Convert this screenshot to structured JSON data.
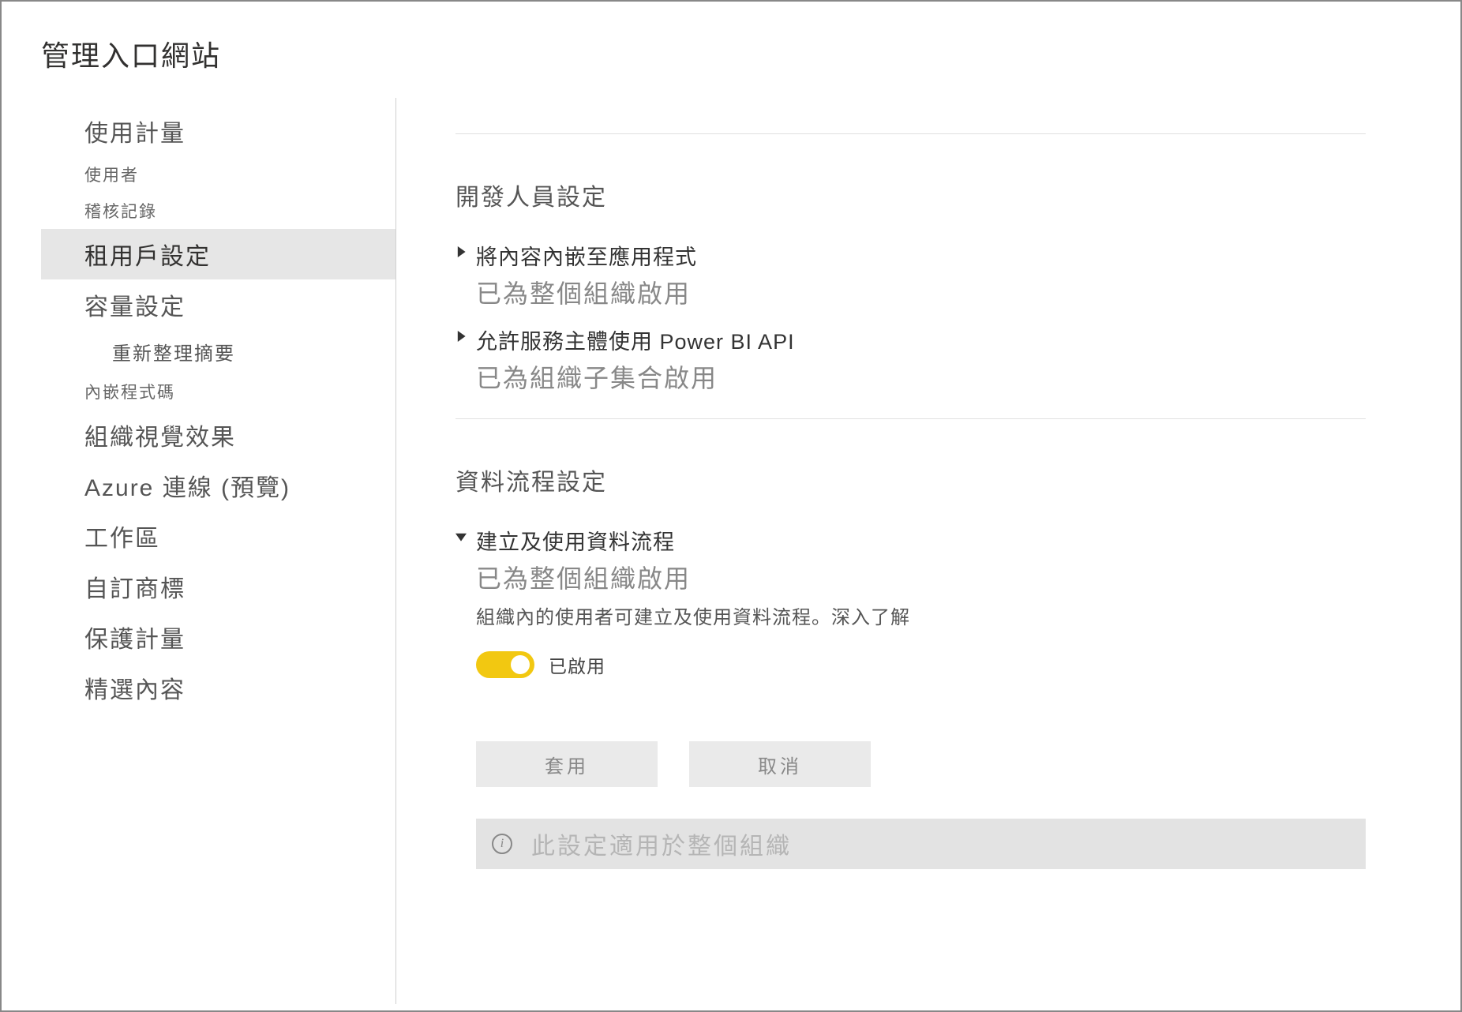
{
  "page": {
    "title": "管理入口網站"
  },
  "sidebar": {
    "items": [
      {
        "label": "使用計量",
        "cls": "sidebar-item"
      },
      {
        "label": "使用者",
        "cls": "sidebar-item small"
      },
      {
        "label": "稽核記錄",
        "cls": "sidebar-item small"
      },
      {
        "label": "租用戶設定",
        "cls": "sidebar-item active"
      },
      {
        "label": "容量設定",
        "cls": "sidebar-item"
      },
      {
        "label": "重新整理摘要",
        "cls": "sidebar-item indent"
      },
      {
        "label": "內嵌程式碼",
        "cls": "sidebar-item small"
      },
      {
        "label": "組織視覺效果",
        "cls": "sidebar-item"
      },
      {
        "label": "Azure 連線 (預覽)",
        "cls": "sidebar-item"
      },
      {
        "label": "工作區",
        "cls": "sidebar-item"
      },
      {
        "label": "自訂商標",
        "cls": "sidebar-item"
      },
      {
        "label": "保護計量",
        "cls": "sidebar-item"
      },
      {
        "label": "精選內容",
        "cls": "sidebar-item"
      }
    ]
  },
  "sections": {
    "developer": {
      "heading": "開發人員設定",
      "embed": {
        "title": "將內容內嵌至應用程式",
        "status": "已為整個組織啟用"
      },
      "service_principal": {
        "title": "允許服務主體使用 Power BI API",
        "status": "已為組織子集合啟用"
      }
    },
    "dataflow": {
      "heading": "資料流程設定",
      "create": {
        "title": "建立及使用資料流程",
        "status": "已為整個組織啟用",
        "desc": "組織內的使用者可建立及使用資料流程。深入了解",
        "toggle_label": "已啟用"
      }
    }
  },
  "buttons": {
    "apply": "套用",
    "cancel": "取消"
  },
  "banner": {
    "text": "此設定適用於整個組織"
  }
}
